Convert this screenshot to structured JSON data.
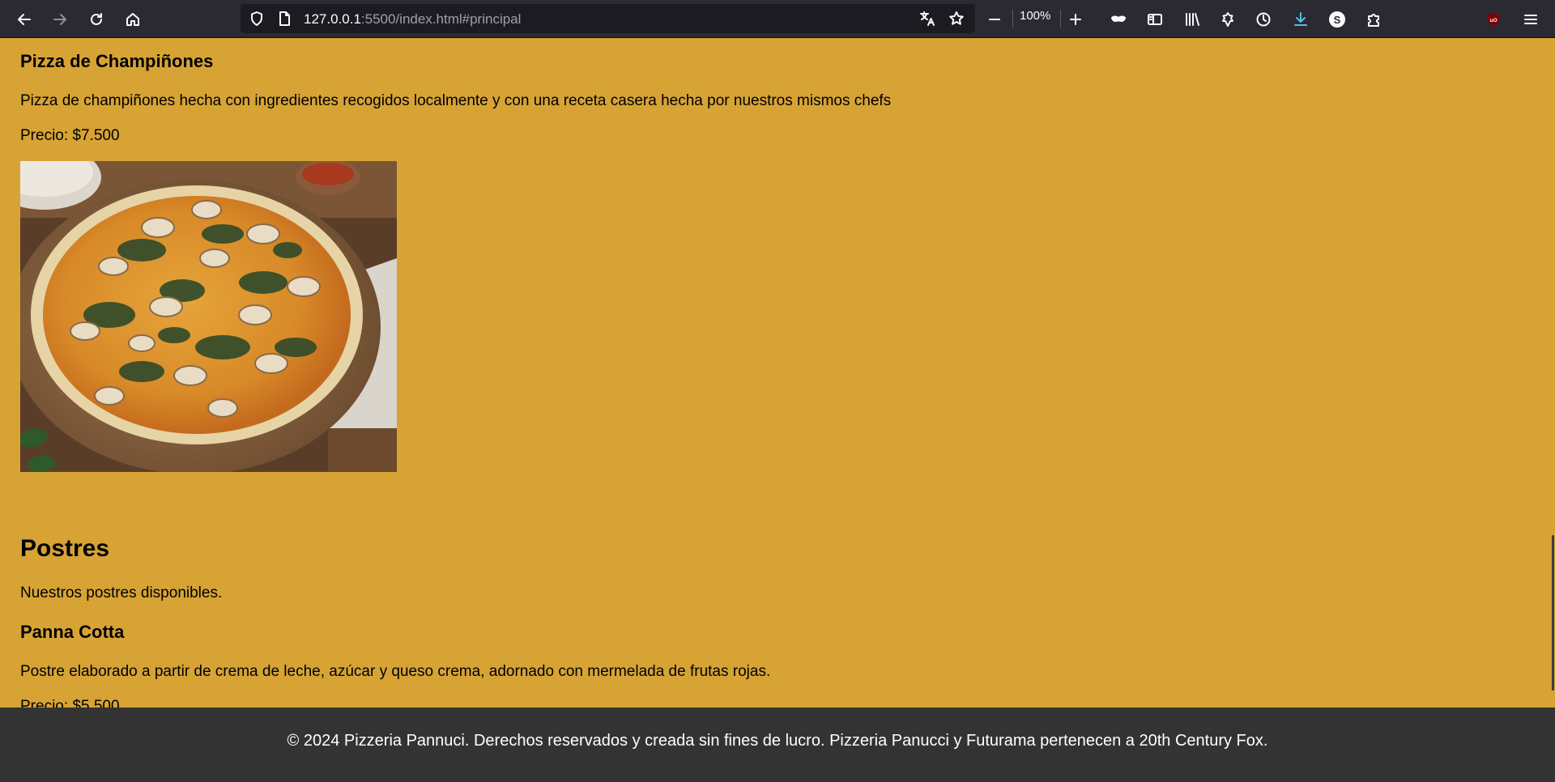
{
  "browser": {
    "url_host": "127.0.0.1",
    "url_rest": ":5500/index.html#principal",
    "zoom": "100%"
  },
  "page": {
    "item1": {
      "title": "Pizza de Champiñones",
      "description": "Pizza de champiñones hecha con ingredientes recogidos localmente y con una receta casera hecha por nuestros mismos chefs",
      "price": "Precio: $7.500"
    },
    "section": {
      "title": "Postres",
      "subtitle": "Nuestros postres disponibles."
    },
    "item2": {
      "title": "Panna Cotta",
      "description": "Postre elaborado a partir de crema de leche, azúcar y queso crema, adornado con mermelada de frutas rojas.",
      "price": "Precio: $5.500"
    }
  },
  "footer": {
    "text": "© 2024 Pizzeria Pannuci. Derechos reservados y creada sin fines de lucro. Pizzeria Panucci y Futurama pertenecen a 20th Century Fox."
  },
  "colors": {
    "page_background": "#d7a334",
    "footer_background": "#333333",
    "chrome_background": "#2b2a33",
    "urlbar_background": "#1c1b22",
    "download_accent": "#54c0e4",
    "ublock_red": "#800000"
  }
}
